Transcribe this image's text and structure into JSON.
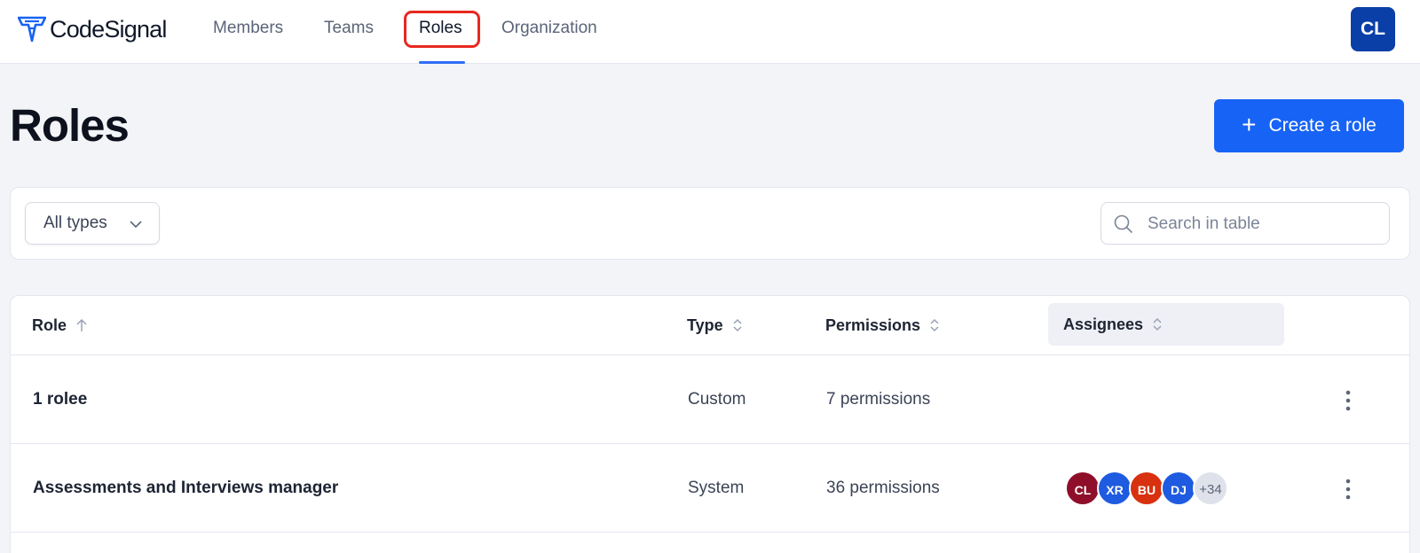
{
  "app": {
    "name": "CodeSignal"
  },
  "nav": {
    "items": [
      {
        "label": "Members"
      },
      {
        "label": "Teams"
      },
      {
        "label": "Roles"
      },
      {
        "label": "Organization"
      }
    ],
    "active": "Roles",
    "user_initials": "CL"
  },
  "page": {
    "title": "Roles",
    "create_button": "Create a role"
  },
  "filters": {
    "type_select": "All types",
    "search_placeholder": "Search in table"
  },
  "table": {
    "columns": [
      {
        "label": "Role",
        "sort": "ascending"
      },
      {
        "label": "Type",
        "sort": "none"
      },
      {
        "label": "Permissions",
        "sort": "none"
      },
      {
        "label": "Assignees",
        "sort": "none"
      }
    ],
    "rows": [
      {
        "role": "1 rolee",
        "type": "Custom",
        "permissions": "7 permissions",
        "assignees": []
      },
      {
        "role": "Assessments and Interviews manager",
        "type": "System",
        "permissions": "36 permissions",
        "assignees": [
          {
            "initials": "CL",
            "color": "#8f0f2a"
          },
          {
            "initials": "XR",
            "color": "#1e5be0"
          },
          {
            "initials": "BU",
            "color": "#d7310f"
          },
          {
            "initials": "DJ",
            "color": "#1e5be0"
          }
        ],
        "assignees_more": "+34"
      }
    ]
  },
  "colors": {
    "accent": "#1763f5",
    "nav_highlight": "#e8281f",
    "user_avatar": "#0b3fa8"
  }
}
